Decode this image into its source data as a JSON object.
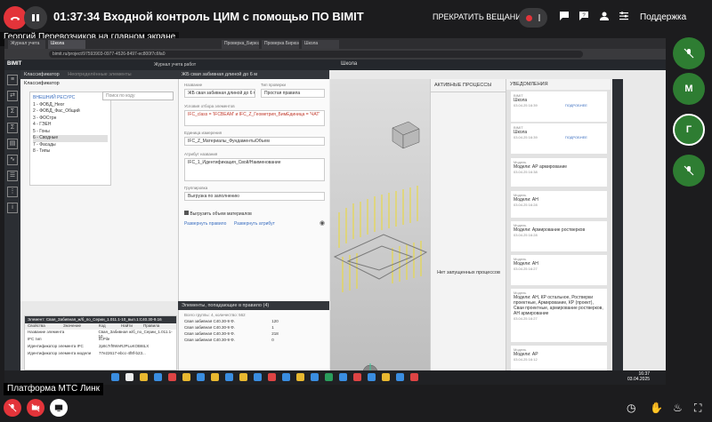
{
  "call": {
    "timer": "01:37:34",
    "title": "Входной контроль ЦИМ с помощью ПО BIMIT",
    "stop_stream": "ПРЕКРАТИТЬ ВЕЩАНИЕ",
    "support": "Поддержка",
    "speaker_overlay": "Георгий Перевозчиков на главном экране",
    "platform_label": "Платформа МТС Линк"
  },
  "participants": [
    {
      "initial": "",
      "color": "#2e7d32",
      "icon": "mic-off-icon"
    },
    {
      "initial": "М",
      "color": "#2e7d32",
      "icon": ""
    },
    {
      "initial": "Г",
      "color": "#2e7d32",
      "icon": ""
    },
    {
      "initial": "",
      "color": "#2e7d32",
      "icon": "mic-off-icon"
    }
  ],
  "browser": {
    "tabs": [
      "Журнал учета",
      "Школа",
      "Проверка_Бирюзов...",
      "Проверка Бирюзов...",
      "Школа"
    ],
    "address": "bimit.ru/project/97593903-0977-4526-8497-ec800f7c6fa0",
    "app_logo": "BIMIT",
    "project_label": "Журнал учета работ",
    "center_title": "Школа"
  },
  "classifier": {
    "header": "Классификатор",
    "tabs": [
      "Классификатор",
      "Неопределённые элементы",
      "Неопределённые атрибуты"
    ],
    "tree_title": "ВНЕШНИЙ РЕСУРС",
    "tree_items": [
      "1 - ФОБД_Неог",
      "2 - ФОБД_Фас_Общий",
      "3 - ФОСтрн",
      "4 - ГЭЕН",
      "5 - Гоны",
      "6 - Сводные",
      "7 - Фасады",
      "8 - Типы"
    ],
    "search_placeholder": "Поиск по коду"
  },
  "properties": {
    "header": "ЖБ свая забивная длиной до 6 м",
    "name_label": "Название",
    "name_value": "ЖБ свая забивная длиной до 6 м",
    "type_label": "Тип проверки",
    "type_value": "Простая правила",
    "rule_label": "Условия отбора элементов",
    "rule_value": "IFC_class = 'IFCBEAM' и IFC_Z_Геометрия_БимЕдиница = 'ЧАТ'",
    "volume_label": "Единица измерения",
    "volume_value": "IFC_Z_Материалы_ФундаментыОбъем",
    "attr_label": "Атрибут названия",
    "attr_value": "IFC_1_Идентификация_Свой/Наименование",
    "group_label": "Группировка",
    "group_value": "Выгрузка по заполнению",
    "checkbox_label": "Выгрузить объем материалов",
    "link1": "Развернуть правило",
    "link2": "Развернуть атрибут"
  },
  "elements": {
    "header": "Элементы, попадающие в правило (4)",
    "subheader": "Всего группы: 4, количество: 562",
    "rows": [
      {
        "name": "Свая забивная С40.30-9 Ф.",
        "count": "120",
        "vol": "0.0"
      },
      {
        "name": "Свая забивная С40.30-9 Ф.",
        "count": "1",
        "vol": "0.0"
      },
      {
        "name": "Свая забивная С40.30-9 Ф.",
        "count": "218",
        "vol": "0.0"
      },
      {
        "name": "Свая забивная С40.30-9 Ф.",
        "count": "0",
        "vol": "0.0"
      }
    ]
  },
  "element_props": {
    "header": "Элемент: Свая_Забивная_ж/б_по_Серии_1.011.1-10_вып.1:C40.30-9.16",
    "columns": [
      "Свойства",
      "Значение",
      "Код",
      "Найти",
      "Правила"
    ],
    "rows": [
      {
        "k": "Название элемента",
        "v": "Свая_Забивная ж/б_по_Серии_1.011.1-10"
      },
      {
        "k": "IFC тип",
        "v": "IfcPile"
      },
      {
        "k": "Идентификатор элемента IFC",
        "v": "2p8c7rf9WvRJPLuKOB6tLX"
      },
      {
        "k": "Идентификатор элемента модели",
        "v": "77e22617-ebcc-4f8f-b23..."
      }
    ]
  },
  "processes": {
    "header": "АКТИВНЫЕ ПРОЦЕССЫ",
    "empty_text": "Нет запущенных процессов"
  },
  "notifications": {
    "header": "УВЕДОМЛЕНИЯ",
    "items": [
      {
        "author": "BIMIT",
        "text": "Школа",
        "date": "03.04.25 16:39",
        "link": "ПОДРОБНЕЕ"
      },
      {
        "author": "BIMIT",
        "text": "Школа",
        "date": "03.04.25 16:39",
        "link": "ПОДРОБНЕЕ"
      },
      {
        "author": "Модель",
        "text": "Модели: АР армирование",
        "date": "03.04.25 16:38",
        "link": ""
      },
      {
        "author": "Модель",
        "text": "Модели: АН",
        "date": "03.04.25 16:28",
        "link": ""
      },
      {
        "author": "Модель",
        "text": "Модели: Армирование ростверков",
        "date": "03.04.25 16:28",
        "link": ""
      },
      {
        "author": "Модель",
        "text": "Модели: АН",
        "date": "03.04.25 16:27",
        "link": ""
      },
      {
        "author": "Модель",
        "text": "Модели: АН, КР остальное, Ростверки проектные, Армирование, КР (проект), Сваи проектные, армирование ростверков, АН армирование",
        "date": "03.04.25 16:27",
        "link": ""
      },
      {
        "author": "Модель",
        "text": "Модели: АР",
        "date": "03.04.25 16:12",
        "link": ""
      }
    ]
  },
  "taskbar": {
    "time": "16:37",
    "date": "03.04.2025"
  }
}
